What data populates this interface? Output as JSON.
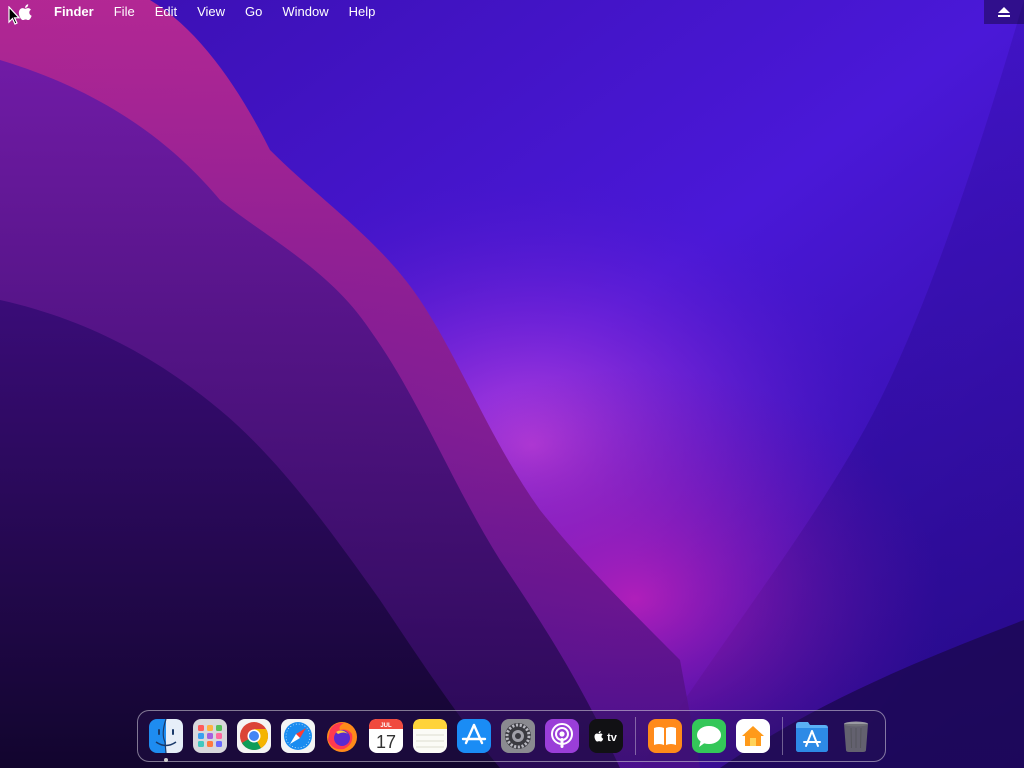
{
  "menubar": {
    "apple_icon": "apple-logo-icon",
    "app_name": "Finder",
    "items": [
      {
        "label": "File"
      },
      {
        "label": "Edit"
      },
      {
        "label": "View"
      },
      {
        "label": "Go"
      },
      {
        "label": "Window"
      },
      {
        "label": "Help"
      }
    ],
    "eject_icon": "eject-icon"
  },
  "dock": {
    "apps": [
      {
        "name": "Finder",
        "icon": "finder-icon",
        "running": true
      },
      {
        "name": "Launchpad",
        "icon": "launchpad-icon"
      },
      {
        "name": "Google Chrome",
        "icon": "chrome-icon"
      },
      {
        "name": "Safari",
        "icon": "safari-icon"
      },
      {
        "name": "Firefox",
        "icon": "firefox-icon"
      },
      {
        "name": "Calendar",
        "icon": "calendar-icon",
        "month": "JUL",
        "day": "17"
      },
      {
        "name": "Notes",
        "icon": "notes-icon"
      },
      {
        "name": "App Store",
        "icon": "app-store-icon"
      },
      {
        "name": "System Preferences",
        "icon": "system-preferences-icon"
      },
      {
        "name": "Podcasts",
        "icon": "podcasts-icon"
      },
      {
        "name": "Apple TV",
        "icon": "apple-tv-icon",
        "label": "tv"
      },
      {
        "name": "Books",
        "icon": "books-icon"
      },
      {
        "name": "Messages",
        "icon": "messages-icon"
      },
      {
        "name": "Home",
        "icon": "home-icon"
      },
      {
        "name": "Applications",
        "icon": "applications-folder-icon"
      },
      {
        "name": "Trash",
        "icon": "trash-icon"
      }
    ]
  },
  "colors": {
    "wallpaper_top": "#3a16c8",
    "wallpaper_glow": "#c030d0",
    "wallpaper_dark": "#12052e"
  }
}
